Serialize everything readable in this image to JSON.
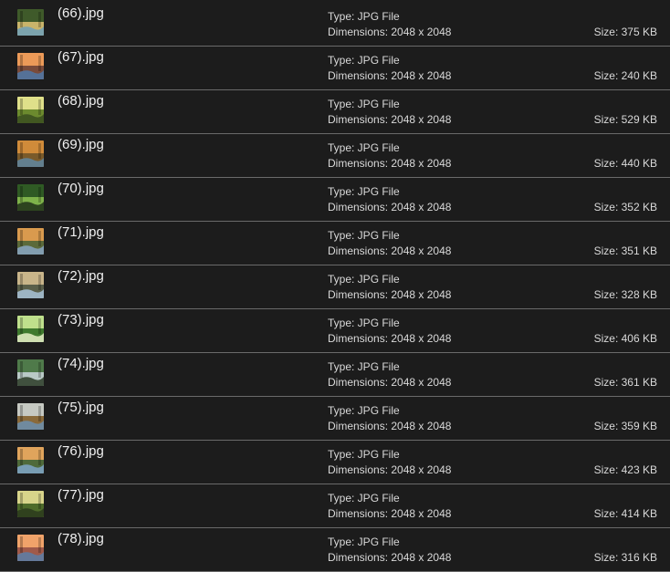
{
  "files": [
    {
      "name": "(66).jpg",
      "type": "Type: JPG File",
      "dimensions": "Dimensions: 2048 x 2048",
      "size": "Size: 375 KB",
      "thumb": {
        "icon": "forest-stream-thumbnail",
        "c1": "#3f5a2a",
        "c2": "#c9b46a",
        "c3": "#6fa0b8"
      }
    },
    {
      "name": "(67).jpg",
      "type": "Type: JPG File",
      "dimensions": "Dimensions: 2048 x 2048",
      "size": "Size: 240 KB",
      "thumb": {
        "icon": "sunset-lake-thumbnail",
        "c1": "#ec9a58",
        "c2": "#7a4b3a",
        "c3": "#4f78a8"
      }
    },
    {
      "name": "(68).jpg",
      "type": "Type: JPG File",
      "dimensions": "Dimensions: 2048 x 2048",
      "size": "Size: 529 KB",
      "thumb": {
        "icon": "sunlit-forest-thumbnail",
        "c1": "#dfe08a",
        "c2": "#6c8a2e",
        "c3": "#3a4e1e"
      }
    },
    {
      "name": "(69).jpg",
      "type": "Type: JPG File",
      "dimensions": "Dimensions: 2048 x 2048",
      "size": "Size: 440 KB",
      "thumb": {
        "icon": "autumn-river-thumbnail",
        "c1": "#d08b3a",
        "c2": "#7a5a2a",
        "c3": "#5f86a0"
      }
    },
    {
      "name": "(70).jpg",
      "type": "Type: JPG File",
      "dimensions": "Dimensions: 2048 x 2048",
      "size": "Size: 352 KB",
      "thumb": {
        "icon": "green-forest-path-thumbnail",
        "c1": "#2f5a24",
        "c2": "#7eb24a",
        "c3": "#1e3018"
      }
    },
    {
      "name": "(71).jpg",
      "type": "Type: JPG File",
      "dimensions": "Dimensions: 2048 x 2048",
      "size": "Size: 351 KB",
      "thumb": {
        "icon": "golden-valley-thumbnail",
        "c1": "#d99a4e",
        "c2": "#5b6a3a",
        "c3": "#8aa6c4"
      }
    },
    {
      "name": "(72).jpg",
      "type": "Type: JPG File",
      "dimensions": "Dimensions: 2048 x 2048",
      "size": "Size: 328 KB",
      "thumb": {
        "icon": "misty-lake-thumbnail",
        "c1": "#c9b58a",
        "c2": "#5a5f4a",
        "c3": "#a9c3d8"
      }
    },
    {
      "name": "(73).jpg",
      "type": "Type: JPG File",
      "dimensions": "Dimensions: 2048 x 2048",
      "size": "Size: 406 KB",
      "thumb": {
        "icon": "bright-meadow-thumbnail",
        "c1": "#bfe08c",
        "c2": "#3f7a2e",
        "c3": "#e9f1c8"
      }
    },
    {
      "name": "(74).jpg",
      "type": "Type: JPG File",
      "dimensions": "Dimensions: 2048 x 2048",
      "size": "Size: 361 KB",
      "thumb": {
        "icon": "forest-waterfall-thumbnail",
        "c1": "#4f7a4a",
        "c2": "#b9c9c6",
        "c3": "#2a3b26"
      }
    },
    {
      "name": "(75).jpg",
      "type": "Type: JPG File",
      "dimensions": "Dimensions: 2048 x 2048",
      "size": "Size: 359 KB",
      "thumb": {
        "icon": "river-bend-thumbnail",
        "c1": "#c6c9c2",
        "c2": "#8a6a3a",
        "c3": "#6b8fb0"
      }
    },
    {
      "name": "(76).jpg",
      "type": "Type: JPG File",
      "dimensions": "Dimensions: 2048 x 2048",
      "size": "Size: 423 KB",
      "thumb": {
        "icon": "mountain-lake-thumbnail",
        "c1": "#e0a45c",
        "c2": "#4f6a3a",
        "c3": "#7fa6c9"
      }
    },
    {
      "name": "(77).jpg",
      "type": "Type: JPG File",
      "dimensions": "Dimensions: 2048 x 2048",
      "size": "Size: 414 KB",
      "thumb": {
        "icon": "tall-trees-thumbnail",
        "c1": "#d8d48a",
        "c2": "#4e6b2a",
        "c3": "#2b3a1c"
      }
    },
    {
      "name": "(78).jpg",
      "type": "Type: JPG File",
      "dimensions": "Dimensions: 2048 x 2048",
      "size": "Size: 316 KB",
      "thumb": {
        "icon": "sunset-shore-thumbnail",
        "c1": "#f0a36a",
        "c2": "#a05a4a",
        "c3": "#5b7fa8"
      }
    }
  ]
}
